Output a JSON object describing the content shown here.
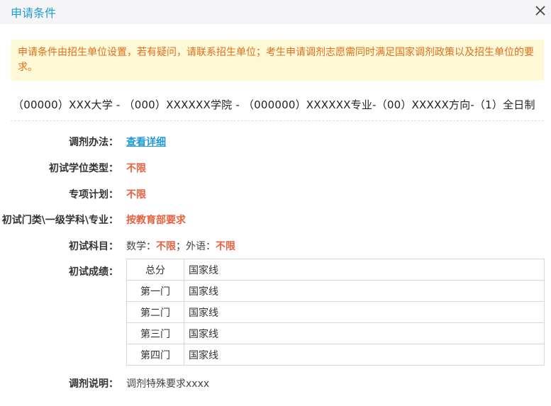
{
  "dialog": {
    "title": "申请条件"
  },
  "notice": "申请条件由招生单位设置，若有疑问，请联系招生单位；考生申请调剂志愿需同时满足国家调剂政策以及招生单位的要求。",
  "program": "（00000）XXX大学 - （000）XXXXXX学院 - （000000）XXXXXX专业-（00）XXXXX方向-（1）全日制",
  "fields": {
    "method": {
      "label": "调剂办法：",
      "value": "查看详细"
    },
    "degree_type": {
      "label": "初试学位类型：",
      "value": "不限"
    },
    "special_plan": {
      "label": "专项计划：",
      "value": "不限"
    },
    "subject_category": {
      "label": "初试门类\\一级学科\\专业：",
      "value": "按教育部要求"
    },
    "exam_subjects": {
      "label": "初试科目：",
      "math_label": "数学：",
      "math_value": "不限",
      "sep": "；",
      "lang_label": "外语：",
      "lang_value": "不限"
    },
    "scores": {
      "label": "初试成绩：",
      "rows": [
        {
          "name": "总分",
          "value": "国家线"
        },
        {
          "name": "第一门",
          "value": "国家线"
        },
        {
          "name": "第二门",
          "value": "国家线"
        },
        {
          "name": "第三门",
          "value": "国家线"
        },
        {
          "name": "第四门",
          "value": "国家线"
        }
      ]
    },
    "note": {
      "label": "调剂说明：",
      "value": "调剂特殊要求xxxx"
    }
  },
  "colors": {
    "accent": "#1e9bd7",
    "highlight": "#e8603c",
    "notice_bg": "#fdf9d6",
    "notice_text": "#e36d1b"
  },
  "icons": {
    "close": "close-icon"
  }
}
